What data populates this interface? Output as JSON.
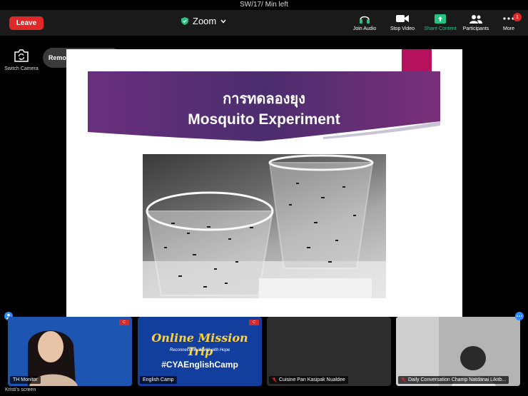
{
  "status_bar": {
    "title": "SW/17/ Min left"
  },
  "toolbar": {
    "leave_label": "Leave",
    "app_name": "Zoom",
    "items": [
      {
        "label": "Join Audio",
        "icon": "headphones-icon"
      },
      {
        "label": "Stop Video",
        "icon": "video-camera-icon"
      },
      {
        "label": "Share Content",
        "icon": "share-screen-icon"
      },
      {
        "label": "Participants",
        "icon": "participants-icon"
      },
      {
        "label": "More",
        "icon": "more-icon",
        "badge": "1"
      }
    ],
    "share_color": "#26c281",
    "leave_color": "#e02828"
  },
  "side": {
    "switch_camera_label": "Switch Camera",
    "spotlight_label": "Remove All Spotlights"
  },
  "shared_content": {
    "thai_title": "การทดลองยุง",
    "english_title": "Mosquito Experiment",
    "accent_color": "#b5115d",
    "banner_color": "#5b2f78"
  },
  "participants": [
    {
      "name": "TH Monitor",
      "mic_muted": false
    },
    {
      "name": "English Camp",
      "mic_muted": false,
      "title": "Online Mission Trip",
      "subtitle": "Reconnect the World with Hope",
      "hashtag": "#CYAEnglishCamp"
    },
    {
      "name": "Cuisine Pan Kasipak Nualdee",
      "mic_muted": true
    },
    {
      "name": "Daily Conversation Champ Natdanai Likitb...",
      "mic_muted": true
    }
  ],
  "screen_owner": "Kristi's screen"
}
